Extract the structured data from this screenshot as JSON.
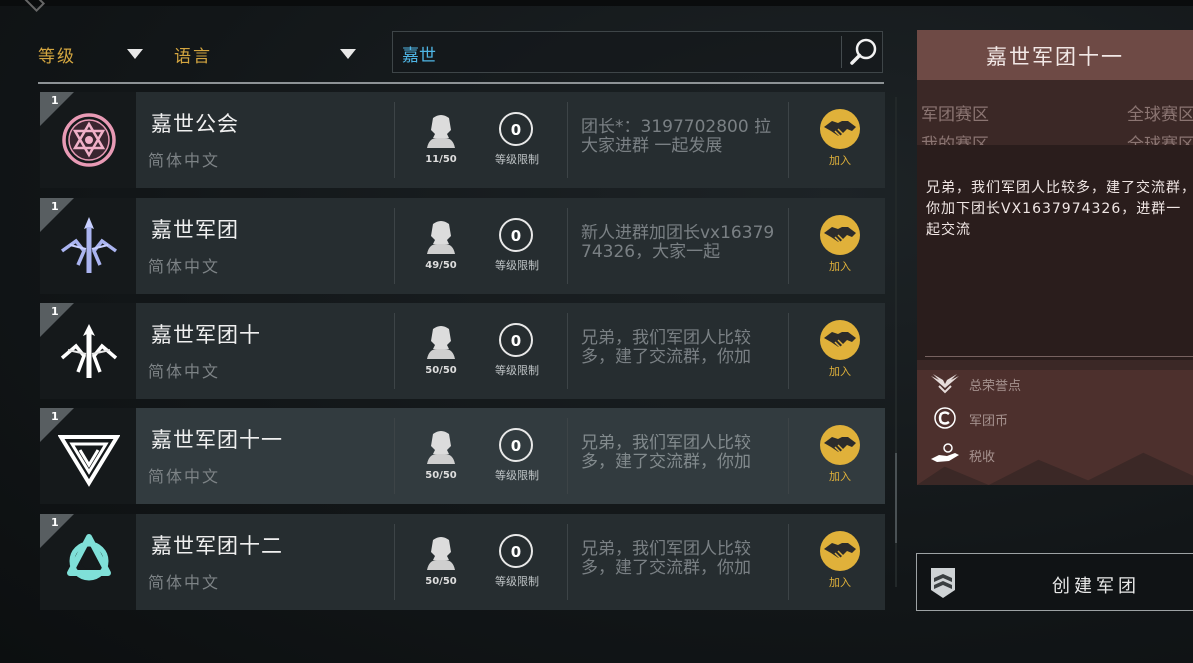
{
  "filters": {
    "level_label": "等级",
    "language_label": "语言"
  },
  "search": {
    "value": "嘉世"
  },
  "guilds": [
    {
      "level": "1",
      "name": "嘉世公会",
      "language": "简体中文",
      "members": "11/50",
      "level_limit_label": "等级限制",
      "notice": "团长*：3197702800 拉大家进群 一起发展",
      "join_label": "加入",
      "emblem": "pink-hexagram-emblem",
      "emblem_color": "#e89ab5"
    },
    {
      "level": "1",
      "name": "嘉世军团",
      "language": "简体中文",
      "members": "49/50",
      "level_limit_label": "等级限制",
      "notice": "新人进群加团长vx1637974326，大家一起",
      "join_label": "加入",
      "emblem": "blue-trident-emblem",
      "emblem_color": "#aab4f0"
    },
    {
      "level": "1",
      "name": "嘉世军团十",
      "language": "简体中文",
      "members": "50/50",
      "level_limit_label": "等级限制",
      "notice": "兄弟，我们军团人比较多，建了交流群，你加",
      "join_label": "加入",
      "emblem": "white-trident-emblem",
      "emblem_color": "#ffffff"
    },
    {
      "level": "1",
      "name": "嘉世军团十一",
      "language": "简体中文",
      "members": "50/50",
      "level_limit_label": "等级限制",
      "notice": "兄弟，我们军团人比较多，建了交流群，你加",
      "join_label": "加入",
      "emblem": "white-triangle-emblem",
      "emblem_color": "#ffffff",
      "selected": true
    },
    {
      "level": "1",
      "name": "嘉世军团十二",
      "language": "简体中文",
      "members": "50/50",
      "level_limit_label": "等级限制",
      "notice": "兄弟，我们军团人比较多，建了交流群，你加",
      "join_label": "加入",
      "emblem": "teal-knot-emblem",
      "emblem_color": "#7fe0d8"
    }
  ],
  "detail": {
    "title": "嘉世军团十一",
    "legion_region_label": "军团赛区",
    "legion_region_value": "全球赛区",
    "my_region_label": "我的赛区",
    "my_region_value": "全球赛区",
    "description": "兄弟，我们军团人比较多，建了交流群，你加下团长VX1637974326，进群一起交流",
    "stats": [
      {
        "label": "总荣誉点",
        "icon": "wings-icon"
      },
      {
        "label": "军团币",
        "icon": "legion-coin-icon"
      },
      {
        "label": "税收",
        "icon": "tax-hand-icon"
      }
    ]
  },
  "create_button": {
    "label": "创建军团",
    "icon": "legion-badge-icon"
  },
  "colors": {
    "accent_gold": "#e0b13a",
    "search_text": "#4fb6e6",
    "panel_header": "#6e4a45"
  }
}
